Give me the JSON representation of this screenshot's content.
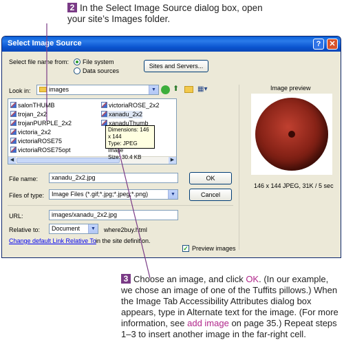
{
  "callouts": {
    "top": {
      "number": "2",
      "text": "In the Select Image Source dialog box, open your site’s Images folder."
    },
    "bottom": {
      "number": "3",
      "part1": "Choose an image, and click ",
      "ok": "OK",
      "part2": ". (In our example, we chose an image of one of the Tuffits pillows.) When the Image Tab Accessibility Attributes dialog box appears, type in Alternate text for the image. (For more information, see ",
      "link": "add image",
      "part3": " on page 35.) Repeat steps 1–3 to insert another image in the far-right cell."
    }
  },
  "dialog": {
    "title": "Select Image Source",
    "help_label": "?",
    "close_label": "✕",
    "select_from_label": "Select file name from:",
    "radio_file_system": "File system",
    "radio_data_sources": "Data sources",
    "sites_button": "Sites and Servers...",
    "look_in_label": "Look in:",
    "look_in_value": "images",
    "files_col1": [
      "salonTHUMB",
      "trojan_2x2",
      "trojanPURPLE_2x2",
      "victoria_2x2",
      "victoriaROSE75",
      "victoriaROSE75opt"
    ],
    "files_col2": [
      "victoriaROSE_2x2",
      "xanadu_2x2",
      "xanaduThumb"
    ],
    "tooltip": {
      "dimensions": "Dimensions: 146 x 144",
      "type": "Type: JPEG Image",
      "size": "Size: 30.4 KB"
    },
    "file_name_label": "File name:",
    "file_name_value": "xanadu_2x2.jpg",
    "ok_button": "OK",
    "files_of_type_label": "Files of type:",
    "files_of_type_value": "Image Files (*.gif;*.jpg;*.jpeg;*.png)",
    "cancel_button": "Cancel",
    "url_label": "URL:",
    "url_value": "images/xanadu_2x2.jpg",
    "relative_label": "Relative to:",
    "relative_value": "Document",
    "relative_page": "where2buy.html",
    "change_link": "Change default Link Relative To",
    "change_suffix": "in the site definition.",
    "preview_checkbox": "Preview images",
    "preview_title": "Image preview",
    "preview_info": "146 x 144 JPEG, 31K / 5 sec"
  }
}
